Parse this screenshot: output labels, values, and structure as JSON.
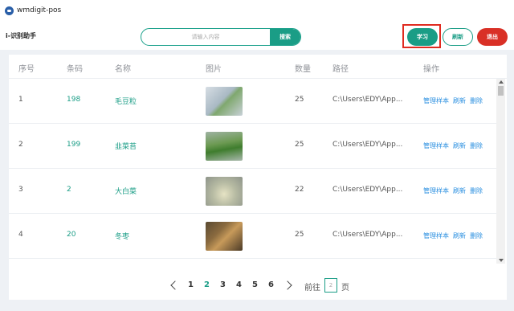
{
  "app": {
    "title": "wmdigit-pos",
    "brand": "i-识别助手"
  },
  "search": {
    "placeholder": "请输入内容",
    "button": "搜索"
  },
  "actions": {
    "learn": "学习",
    "refresh": "刷新",
    "exit": "退出"
  },
  "table": {
    "headers": [
      "序号",
      "条码",
      "名称",
      "图片",
      "数量",
      "路径",
      "操作"
    ],
    "rows": [
      {
        "index": "1",
        "code": "198",
        "name": "毛豆粒",
        "quantity": "25",
        "path": "C:\\Users\\EDY\\App...",
        "thumb_color": "#b9c6cf"
      },
      {
        "index": "2",
        "code": "199",
        "name": "韭菜苔",
        "quantity": "25",
        "path": "C:\\Users\\EDY\\App...",
        "thumb_color": "#6c9a52"
      },
      {
        "index": "3",
        "code": "2",
        "name": "大白菜",
        "quantity": "22",
        "path": "C:\\Users\\EDY\\App...",
        "thumb_color": "#b7bba3"
      },
      {
        "index": "4",
        "code": "20",
        "name": "冬枣",
        "quantity": "25",
        "path": "C:\\Users\\EDY\\App...",
        "thumb_color": "#8a6a3f"
      }
    ],
    "row_actions": {
      "manage": "管理样本",
      "refresh": "刷新",
      "delete": "删除"
    }
  },
  "pagination": {
    "pages": [
      "1",
      "2",
      "3",
      "4",
      "5",
      "6"
    ],
    "current": "2",
    "goto_label": "前往",
    "goto_value": "2",
    "page_label": "页"
  },
  "colors": {
    "accent": "#1a9d86",
    "danger": "#d93026",
    "link": "#2a8fe0",
    "highlight": "#e02b20"
  }
}
